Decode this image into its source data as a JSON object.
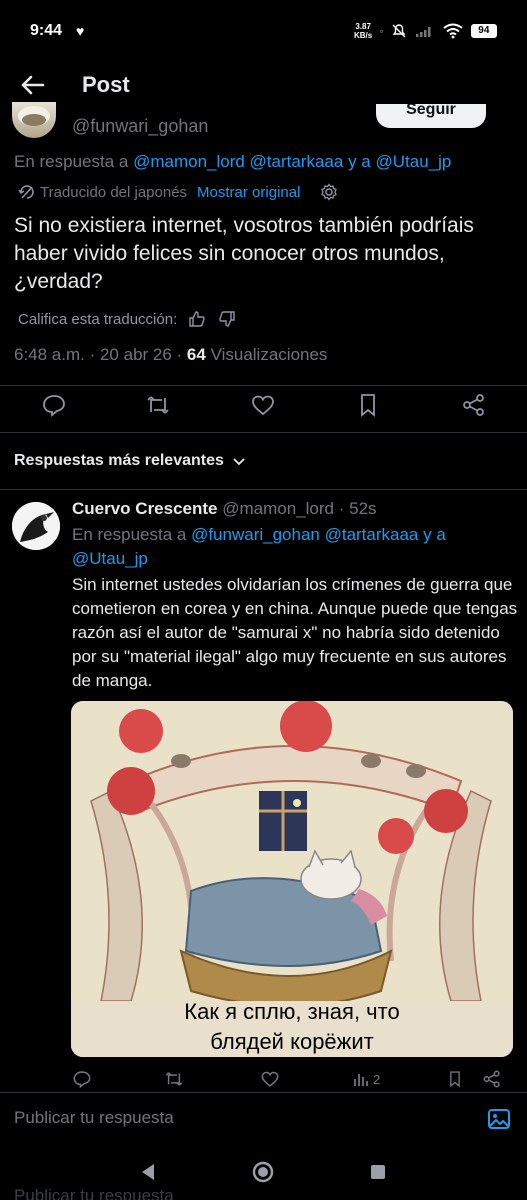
{
  "status_bar": {
    "time": "9:44",
    "speed_value": "3.87",
    "speed_unit": "KB/s",
    "battery": "94"
  },
  "header": {
    "title": "Post"
  },
  "tweet": {
    "handle": "@funwari_gohan",
    "follow_label": "Seguir",
    "reply_prefix": "En respuesta a ",
    "reply_mentions": "@mamon_lord @tartarkaaa",
    "reply_and": " y a ",
    "reply_last": "@Utau_jp",
    "translated_label": "Traducido del japonés",
    "show_original": "Mostrar original",
    "text": "Si no existiera internet, vosotros también podríais haber vivido felices sin conocer otros mundos, ¿verdad?",
    "rate_label": "Califica esta traducción:",
    "timestamp": "6:48 a.m. · 20 abr 26 · ",
    "views_count": "64",
    "views_label": " Visualizaciones"
  },
  "sort": {
    "label": "Respuestas más relevantes"
  },
  "reply": {
    "name": "Cuervo Crescente",
    "handle": "@mamon_lord",
    "separator": " · ",
    "time": "52s",
    "reply_prefix": "En respuesta a ",
    "reply_mentions": "@funwari_gohan @tartarkaaa",
    "reply_and": " y a ",
    "reply_last": "@Utau_jp",
    "text": "Sin internet ustedes olvidarían los crímenes de guerra que cometieron en corea y en china. Aunque puede que tengas razón así el autor de \"samurai x\" no habría sido detenido por su \"material ilegal\" algo muy frecuente en sus autores de manga.",
    "image_caption_line1": "Как я сплю, зная, что",
    "image_caption_line2": "блядей корёжит",
    "views_count": "2"
  },
  "composer": {
    "placeholder": "Publicar tu respuesta",
    "ghost_text": "Publicar tu respuesta"
  },
  "colors": {
    "accent": "#1d9bf0",
    "muted": "#71767b",
    "text": "#e7e9ea",
    "background": "#000000"
  }
}
